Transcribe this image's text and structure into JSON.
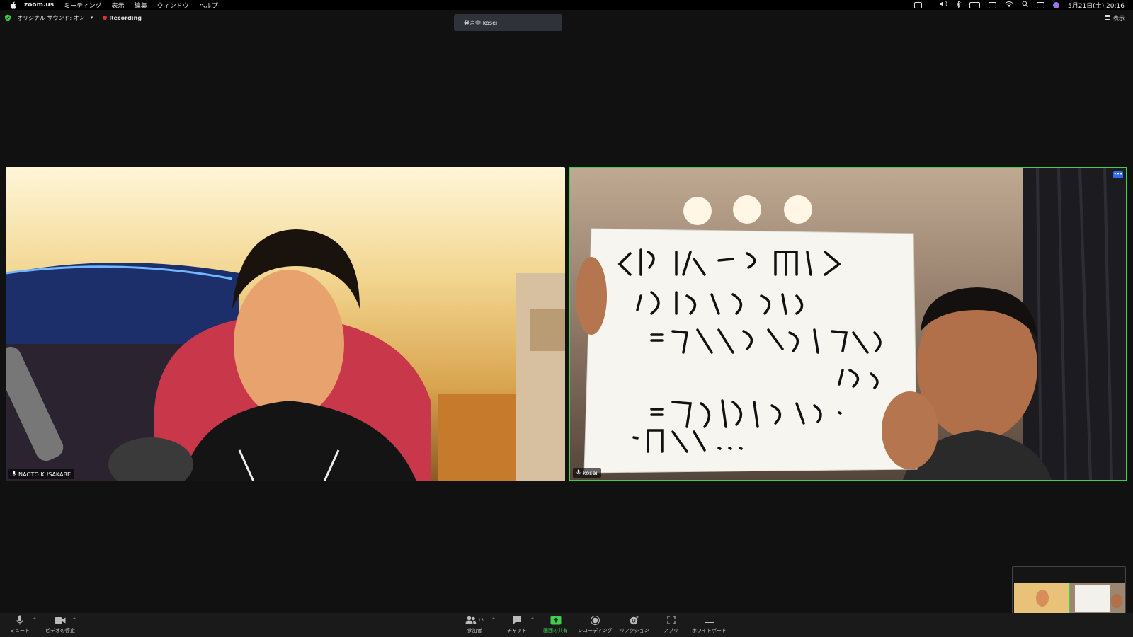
{
  "menubar": {
    "app_name": "zoom.us",
    "items": [
      "ミーティング",
      "表示",
      "編集",
      "ウィンドウ",
      "ヘルプ"
    ],
    "datetime": "5月21日(土) 20:16"
  },
  "meeting": {
    "audio_label": "オリジナル サウンド: オン",
    "recording_label": "Recording",
    "view_label": "表示",
    "speaking_banner": "発言中:kosei"
  },
  "tiles": [
    {
      "name": "NAOTO KUSAKABE"
    },
    {
      "name": "kosei",
      "active": true
    }
  ],
  "toolbar": {
    "mute": "ミュート",
    "video": "ビデオの停止",
    "participants": "参加者",
    "participants_count": "13",
    "chat": "チャット",
    "share": "画面の共有",
    "recording": "レコーディング",
    "reactions": "リアクション",
    "apps": "アプリ",
    "whiteboard": "ホワイトボード"
  },
  "colors": {
    "accent_green": "#3fcf4f",
    "recording_red": "#e0302a",
    "more_blue": "#2b6de8"
  }
}
